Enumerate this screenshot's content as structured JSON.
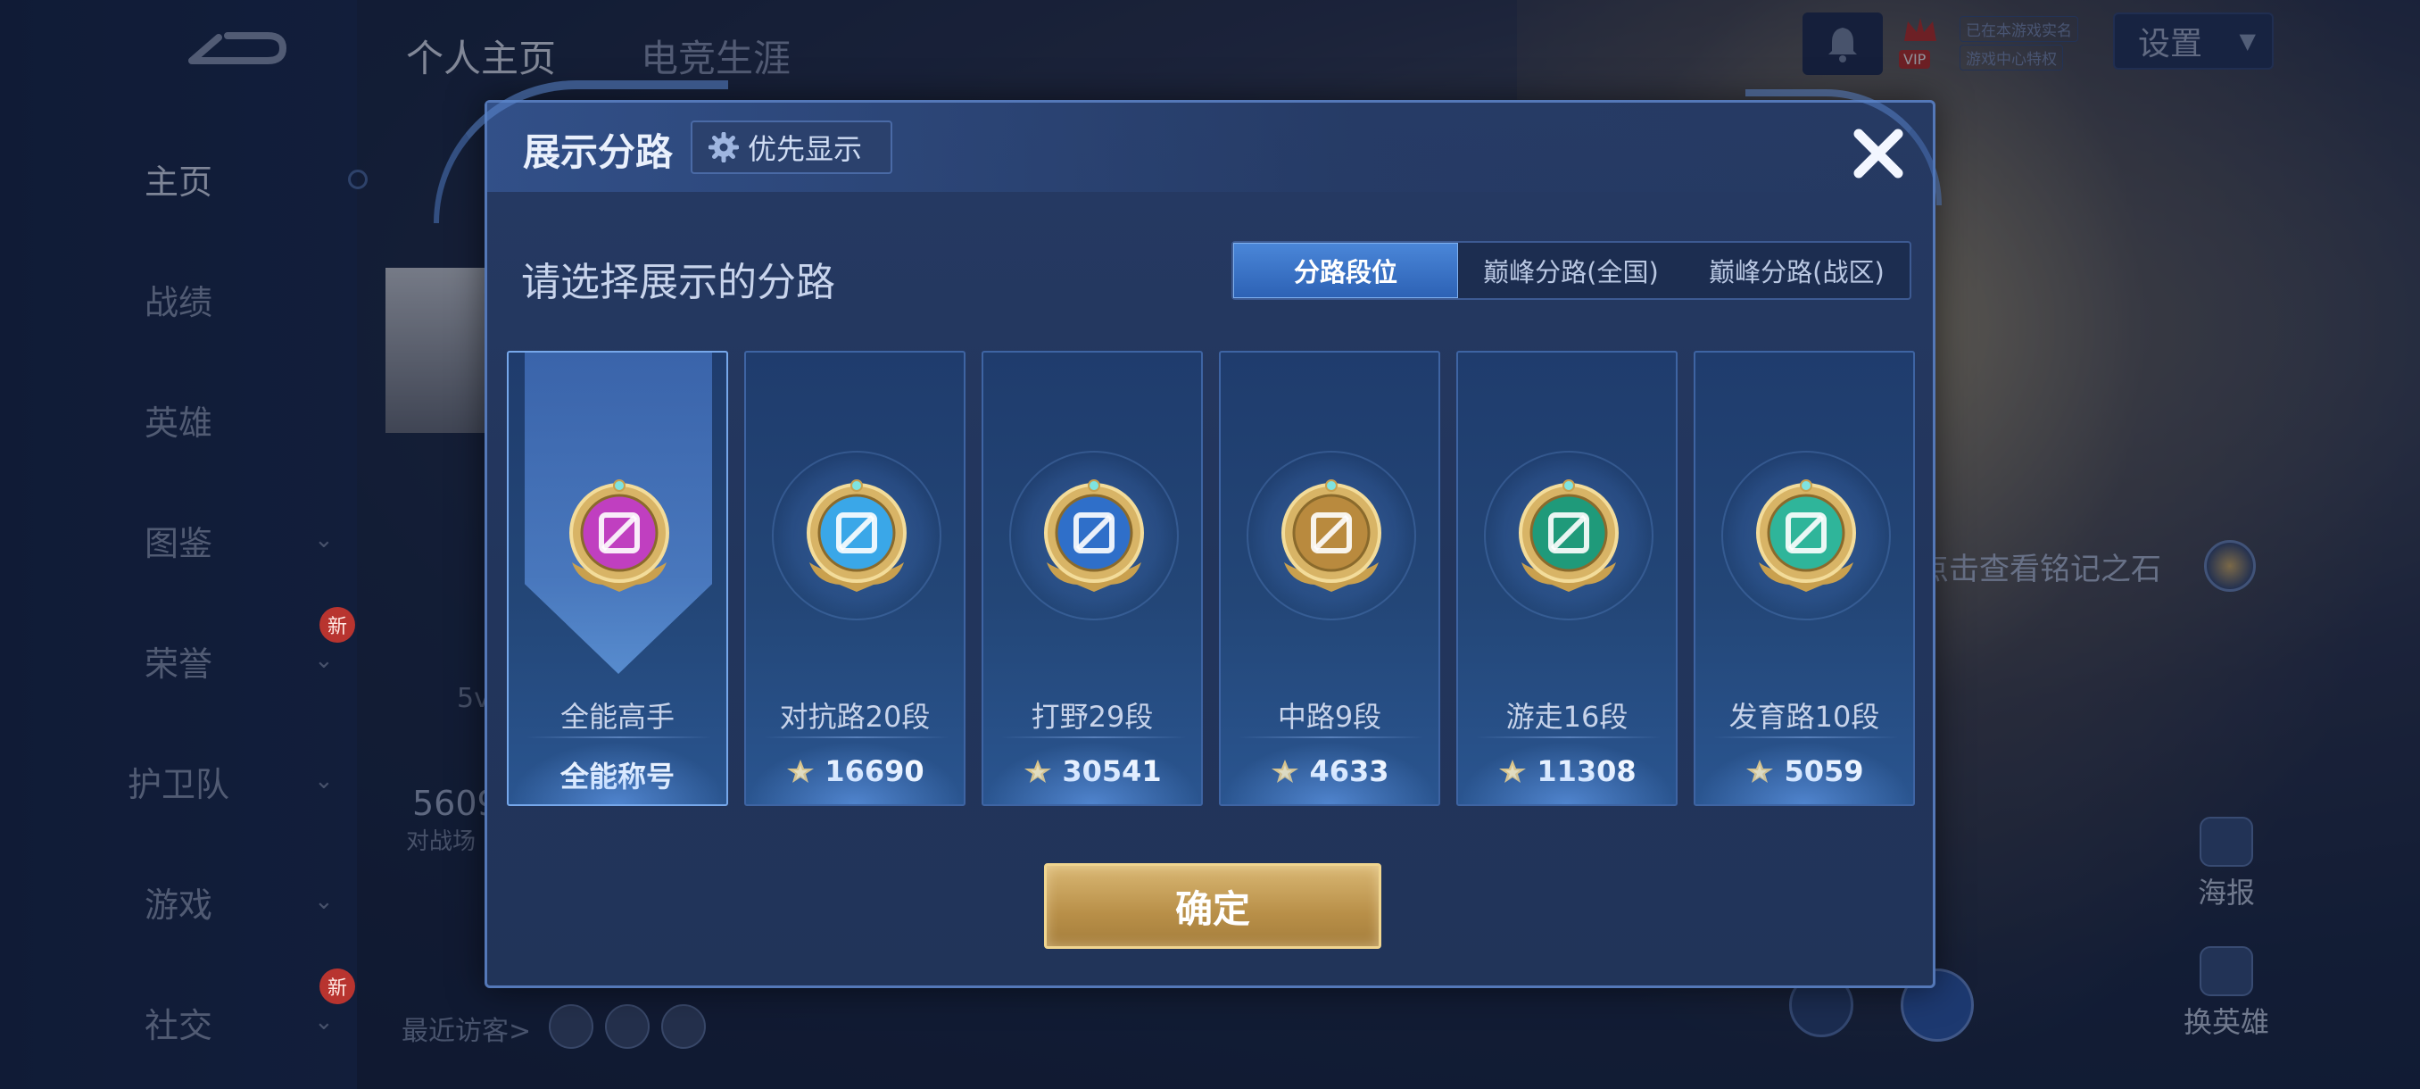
{
  "background": {
    "top_tabs": [
      "个人主页",
      "电竞生涯"
    ],
    "nav_items": [
      {
        "label": "主页",
        "chevron": false,
        "new": false
      },
      {
        "label": "战绩",
        "chevron": false,
        "new": false
      },
      {
        "label": "英雄",
        "chevron": false,
        "new": false
      },
      {
        "label": "图鉴",
        "chevron": true,
        "new": false
      },
      {
        "label": "荣誉",
        "chevron": true,
        "new": true
      },
      {
        "label": "护卫队",
        "chevron": true,
        "new": false
      },
      {
        "label": "游戏",
        "chevron": true,
        "new": false
      },
      {
        "label": "社交",
        "chevron": true,
        "new": true
      }
    ],
    "new_badge": "新",
    "recent_visitors_label": "最近访客>",
    "side_number": "5609",
    "side_number_sub": "对战场",
    "side_5v": "5v",
    "vip_label": "VIP",
    "vip_text_1": "已在本游戏实名",
    "vip_text_2": "游戏中心特权",
    "settings_label": "设置",
    "inscription_hint": "点击查看铭记之石",
    "poster_label": "海报",
    "swap_hero_label": "换英雄"
  },
  "modal": {
    "title": "展示分路",
    "priority_label": "优先显示",
    "subtitle": "请选择展示的分路",
    "segments": [
      "分路段位",
      "巅峰分路(全国)",
      "巅峰分路(战区)"
    ],
    "active_segment": 0,
    "cards": [
      {
        "label": "全能高手",
        "value": "全能称号",
        "has_mark": false,
        "selected": true,
        "emblem_color": "#c03fc0",
        "emblem": "all-round-emblem-icon"
      },
      {
        "label": "对抗路20段",
        "value": "16690",
        "has_mark": true,
        "selected": false,
        "emblem_color": "#3aa7e8",
        "emblem": "clash-lane-emblem-icon"
      },
      {
        "label": "打野29段",
        "value": "30541",
        "has_mark": true,
        "selected": false,
        "emblem_color": "#2f6fc9",
        "emblem": "jungle-emblem-icon"
      },
      {
        "label": "中路9段",
        "value": "4633",
        "has_mark": true,
        "selected": false,
        "emblem_color": "#b98a3e",
        "emblem": "mid-lane-emblem-icon"
      },
      {
        "label": "游走16段",
        "value": "11308",
        "has_mark": true,
        "selected": false,
        "emblem_color": "#1f9a7a",
        "emblem": "roam-emblem-icon"
      },
      {
        "label": "发育路10段",
        "value": "5059",
        "has_mark": true,
        "selected": false,
        "emblem_color": "#2fb59a",
        "emblem": "farm-lane-emblem-icon"
      }
    ],
    "confirm_label": "确定"
  },
  "colors": {
    "accent_blue": "#2d62b5",
    "gold": "#d9b773",
    "panel": "#22355c"
  }
}
